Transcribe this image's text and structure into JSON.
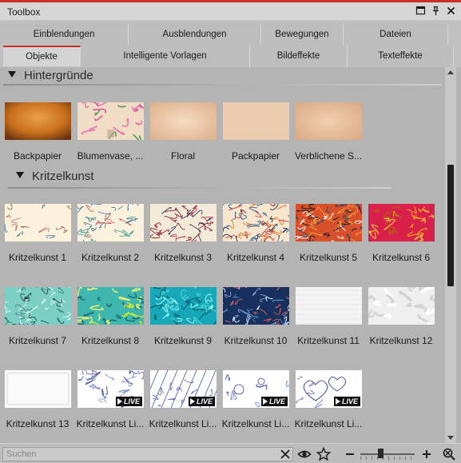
{
  "window": {
    "title": "Toolbox"
  },
  "title_buttons": [
    {
      "name": "restore-button",
      "icon": "window-restore-icon"
    },
    {
      "name": "pin-button",
      "icon": "pin-icon"
    },
    {
      "name": "close-button",
      "icon": "close-icon"
    }
  ],
  "tabs_row1": [
    "Einblendungen",
    "Ausblendungen",
    "Bewegungen",
    "Dateien"
  ],
  "tabs_row2": [
    "Objekte",
    "Intelligente Vorlagen",
    "Bildeffekte",
    "Texteffekte"
  ],
  "active_tab": "Objekte",
  "sections": [
    {
      "title": "Hintergründe",
      "items": [
        {
          "label": "Backpapier",
          "thumb": "backpapier"
        },
        {
          "label": "Blumenvase, ...",
          "thumb": "blumenvase"
        },
        {
          "label": "Floral",
          "thumb": "floral"
        },
        {
          "label": "Packpapier",
          "thumb": "packpapier"
        },
        {
          "label": "Verblichene S...",
          "thumb": "verblichen"
        }
      ]
    },
    {
      "title": "Kritzelkunst",
      "items": [
        {
          "label": "Kritzelkunst 1",
          "thumb": "k1"
        },
        {
          "label": "Kritzelkunst 2",
          "thumb": "k2"
        },
        {
          "label": "Kritzelkunst 3",
          "thumb": "k3"
        },
        {
          "label": "Kritzelkunst 4",
          "thumb": "k4"
        },
        {
          "label": "Kritzelkunst 5",
          "thumb": "k5"
        },
        {
          "label": "Kritzelkunst 6",
          "thumb": "k6"
        },
        {
          "label": "Kritzelkunst 7",
          "thumb": "k7"
        },
        {
          "label": "Kritzelkunst 8",
          "thumb": "k8"
        },
        {
          "label": "Kritzelkunst 9",
          "thumb": "k9"
        },
        {
          "label": "Kritzelkunst 10",
          "thumb": "k10"
        },
        {
          "label": "Kritzelkunst 11",
          "thumb": "k11"
        },
        {
          "label": "Kritzelkunst 12",
          "thumb": "k12"
        },
        {
          "label": "Kritzelkunst 13",
          "thumb": "k13"
        },
        {
          "label": "Kritzelkunst Li...",
          "thumb": "live1",
          "badge": "LIVE"
        },
        {
          "label": "Kritzelkunst Li...",
          "thumb": "live2",
          "badge": "LIVE"
        },
        {
          "label": "Kritzelkunst Li...",
          "thumb": "live3",
          "badge": "LIVE"
        },
        {
          "label": "Kritzelkunst Li...",
          "thumb": "live4",
          "badge": "LIVE"
        }
      ]
    }
  ],
  "search": {
    "placeholder": "Suchen",
    "value": ""
  },
  "bottom_icons": [
    "clear-search-icon",
    "eye-icon",
    "star-icon",
    "zoom-out-icon",
    "zoom-in-icon",
    "zoom-reset-icon"
  ],
  "zoom": {
    "level": 0.38
  },
  "colors": {
    "accent": "#c8302a",
    "background": "#b4b4b4"
  }
}
